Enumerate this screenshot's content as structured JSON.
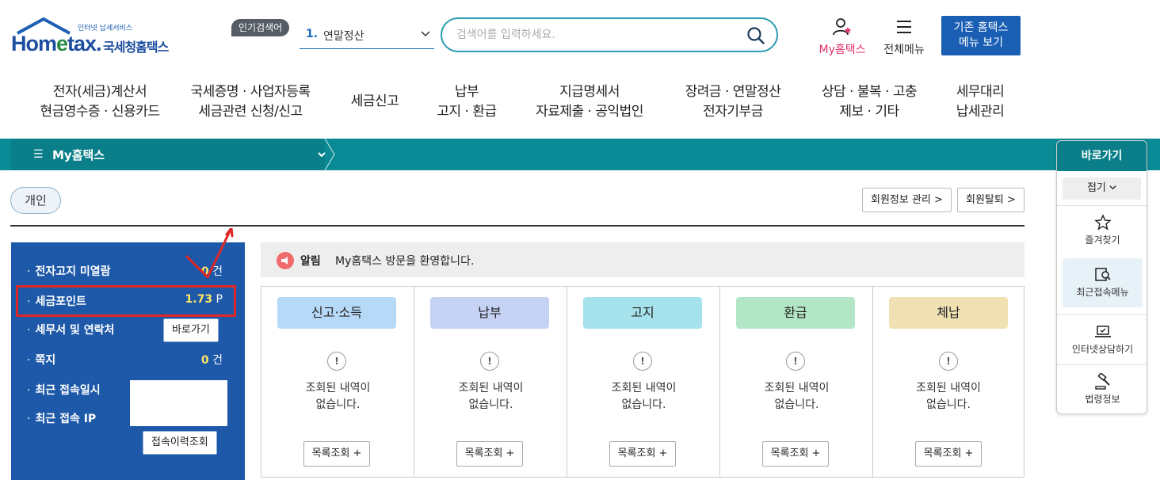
{
  "header": {
    "logo_sub": "인터넷 납세서비스",
    "logo_home": "Hom",
    "logo_e": "e",
    "logo_tax": "tax.",
    "logo_kr": "국세청홈택스",
    "popular_tag": "인기검색어",
    "popular_num": "1.",
    "popular_text": "연말정산",
    "search_placeholder": "검색어를 입력하세요.",
    "myhome": "My홈택스",
    "allmenu": "전체메뉴",
    "old_menu_line1": "기존 홈택스",
    "old_menu_line2": "메뉴 보기"
  },
  "gnb": [
    {
      "l1": "전자(세금)계산서",
      "l2": "현금영수증 · 신용카드"
    },
    {
      "l1": "국세증명 · 사업자등록",
      "l2": "세금관련 신청/신고"
    },
    {
      "l1": "세금신고",
      "l2": ""
    },
    {
      "l1": "납부",
      "l2": "고지 · 환급"
    },
    {
      "l1": "지급명세서",
      "l2": "자료제출 · 공익법인"
    },
    {
      "l1": "장려금 · 연말정산",
      "l2": "전자기부금"
    },
    {
      "l1": "상담 · 불복 · 고충",
      "l2": "제보 · 기타"
    },
    {
      "l1": "세무대리",
      "l2": "납세관리"
    }
  ],
  "breadcrumb": {
    "title": "My홈택스"
  },
  "tabs": {
    "personal": "개인"
  },
  "account": {
    "edit": "회원정보 관리 >",
    "withdraw": "회원탈퇴 >"
  },
  "info": {
    "unread_label": "전자고지 미열람",
    "unread_count": "0",
    "unread_unit": "건",
    "points_label": "세금포인트",
    "points_value": "1.73",
    "points_unit": "P",
    "agent_label": "세무서 및 연락처",
    "agent_button": "바로가기",
    "memo_label": "쪽지",
    "memo_count": "0",
    "memo_unit": "건",
    "last_login_label": "최근 접속일시",
    "last_ip_label": "최근 접속 IP",
    "history_button": "접속이력조회"
  },
  "notice": {
    "tag": "알림",
    "text": "My홈택스 방문을 환영합니다."
  },
  "cards": [
    {
      "title": "신고·소득",
      "color": "#b6d9f7",
      "empty": "조회된 내역이\n없습니다.",
      "button": "목록조회 +"
    },
    {
      "title": "납부",
      "color": "#c5d2f4",
      "empty": "조회된 내역이\n없습니다.",
      "button": "목록조회 +"
    },
    {
      "title": "고지",
      "color": "#a5e2ec",
      "empty": "조회된 내역이\n없습니다.",
      "button": "목록조회 +"
    },
    {
      "title": "환급",
      "color": "#b3e6c6",
      "empty": "조회된 내역이\n없습니다.",
      "button": "목록조회 +"
    },
    {
      "title": "체납",
      "color": "#f0e1b3",
      "empty": "조회된 내역이\n없습니다.",
      "button": "목록조회 +"
    }
  ],
  "quick": {
    "title": "바로가기",
    "fold": "접기",
    "items": [
      "즐겨찾기",
      "최근접속메뉴",
      "인터넷상담하기",
      "법령정보"
    ]
  },
  "colors": {
    "teal": "#0a8a95",
    "panel_blue": "#1d59a8",
    "highlight": "#e02626",
    "myhome_pink": "#e0336a"
  }
}
